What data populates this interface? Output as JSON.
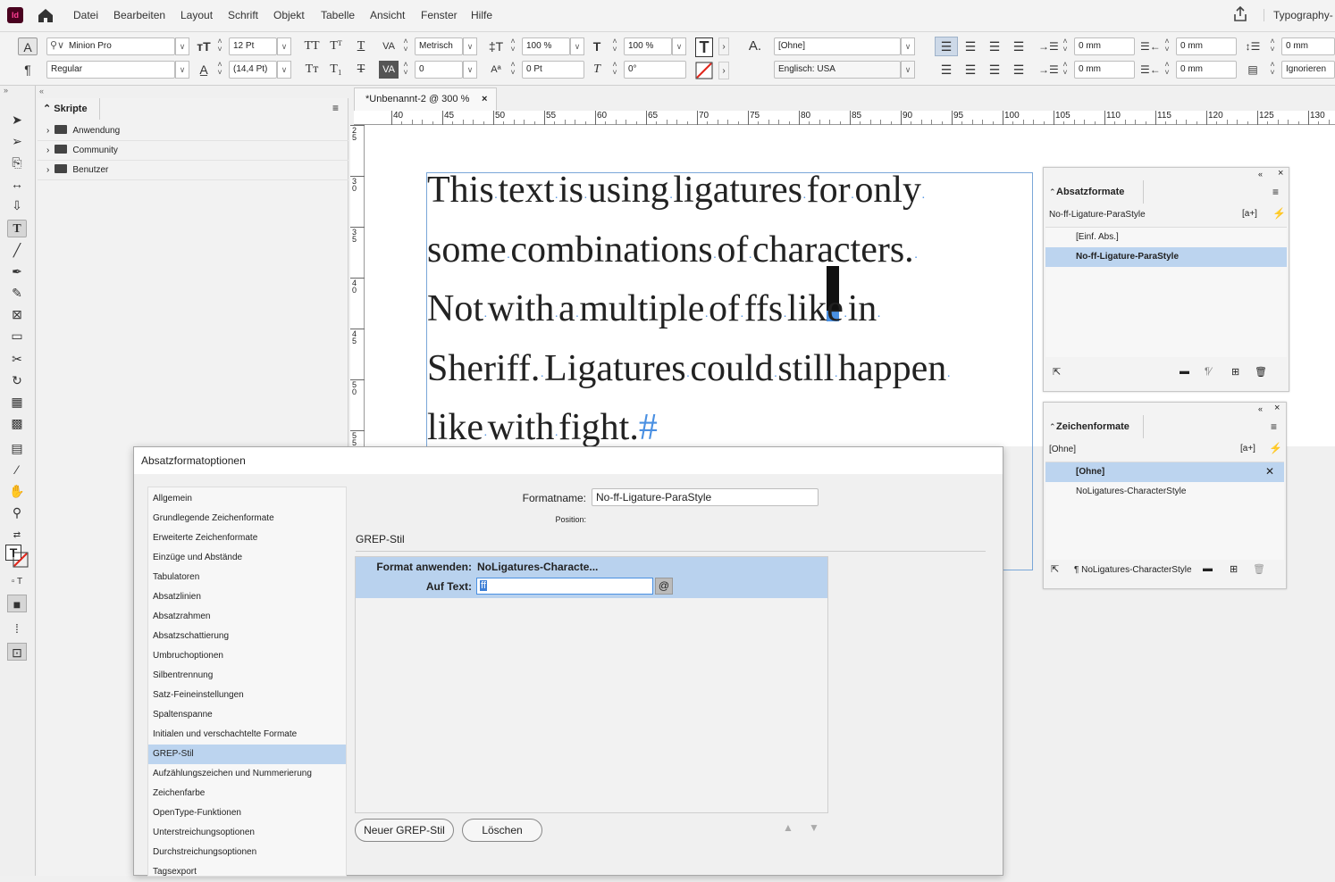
{
  "app": {
    "logo": "Id",
    "workspace": "Typography-"
  },
  "menu": [
    "Datei",
    "Bearbeiten",
    "Layout",
    "Schrift",
    "Objekt",
    "Tabelle",
    "Ansicht",
    "Fenster",
    "Hilfe"
  ],
  "control": {
    "font_family": "Minion Pro",
    "font_style": "Regular",
    "font_size": "12 Pt",
    "leading": "(14,4 Pt)",
    "kerning": "Metrisch",
    "tracking": "0",
    "vscale": "100 %",
    "hscale": "100 %",
    "baseline": "0 Pt",
    "skew": "0°",
    "char_style": "[Ohne]",
    "language": "Englisch: USA",
    "indent_left": "0 mm",
    "indent_right": "0 mm",
    "space_before": "0 mm",
    "first_line": "0 mm",
    "last_line": "0 mm",
    "space_after": "0 mm",
    "grid": "Ignorieren"
  },
  "scripts_panel": {
    "title": "Skripte",
    "items": [
      "Anwendung",
      "Community",
      "Benutzer"
    ]
  },
  "document": {
    "tab_title": "*Unbenannt-2 @ 300 %",
    "ruler_h": [
      "40",
      "45",
      "50",
      "55",
      "60",
      "65",
      "70",
      "75",
      "80",
      "85",
      "90",
      "95",
      "100",
      "105",
      "110",
      "115",
      "120",
      "125",
      "130"
    ],
    "ruler_v": [
      "2 5",
      "3 0",
      "3 5",
      "4 0",
      "4 5",
      "5 0",
      "5 5"
    ],
    "lines": [
      [
        "This",
        "text",
        "is",
        "using",
        "ligatures",
        "for",
        "only"
      ],
      [
        "some",
        "combinations",
        "of",
        "characters."
      ],
      [
        "Not",
        "with",
        "a",
        "multiple",
        "of",
        "ffs",
        "like",
        "in"
      ],
      [
        "Sheriff.",
        "Ligatures",
        "could",
        "still",
        "happen"
      ],
      [
        "like",
        "with",
        "fight."
      ]
    ],
    "end_mark": "#"
  },
  "para_styles": {
    "title": "Absatzformate",
    "current": "No-ff-Ligature-ParaStyle",
    "items": [
      "[Einf. Abs.]",
      "No-ff-Ligature-ParaStyle"
    ],
    "selected_index": 1
  },
  "char_styles": {
    "title": "Zeichenformate",
    "current": "[Ohne]",
    "items": [
      "[Ohne]",
      "NoLigatures-CharacterStyle"
    ],
    "selected_index": 0,
    "footer": "¶ NoLigatures-CharacterStyle"
  },
  "dialog": {
    "title": "Absatzformatoptionen",
    "categories": [
      "Allgemein",
      "Grundlegende Zeichenformate",
      "Erweiterte Zeichenformate",
      "Einzüge und Abstände",
      "Tabulatoren",
      "Absatzlinien",
      "Absatzrahmen",
      "Absatzschattierung",
      "Umbruchoptionen",
      "Silbentrennung",
      "Satz-Feineinstellungen",
      "Spaltenspanne",
      "Initialen und verschachtelte Formate",
      "GREP-Stil",
      "Aufzählungszeichen und Nummerierung",
      "Zeichenfarbe",
      "OpenType-Funktionen",
      "Unterstreichungsoptionen",
      "Durchstreichungsoptionen",
      "Tagsexport"
    ],
    "selected_category": 13,
    "style_name_label": "Formatname:",
    "style_name_value": "No-ff-Ligature-ParaStyle",
    "position_label": "Position:",
    "section_title": "GREP-Stil",
    "apply_label": "Format anwenden:",
    "apply_value": "NoLigatures-Characte...",
    "text_label": "Auf Text:",
    "text_value": "ff",
    "new_button": "Neuer GREP-Stil",
    "delete_button": "Löschen"
  }
}
